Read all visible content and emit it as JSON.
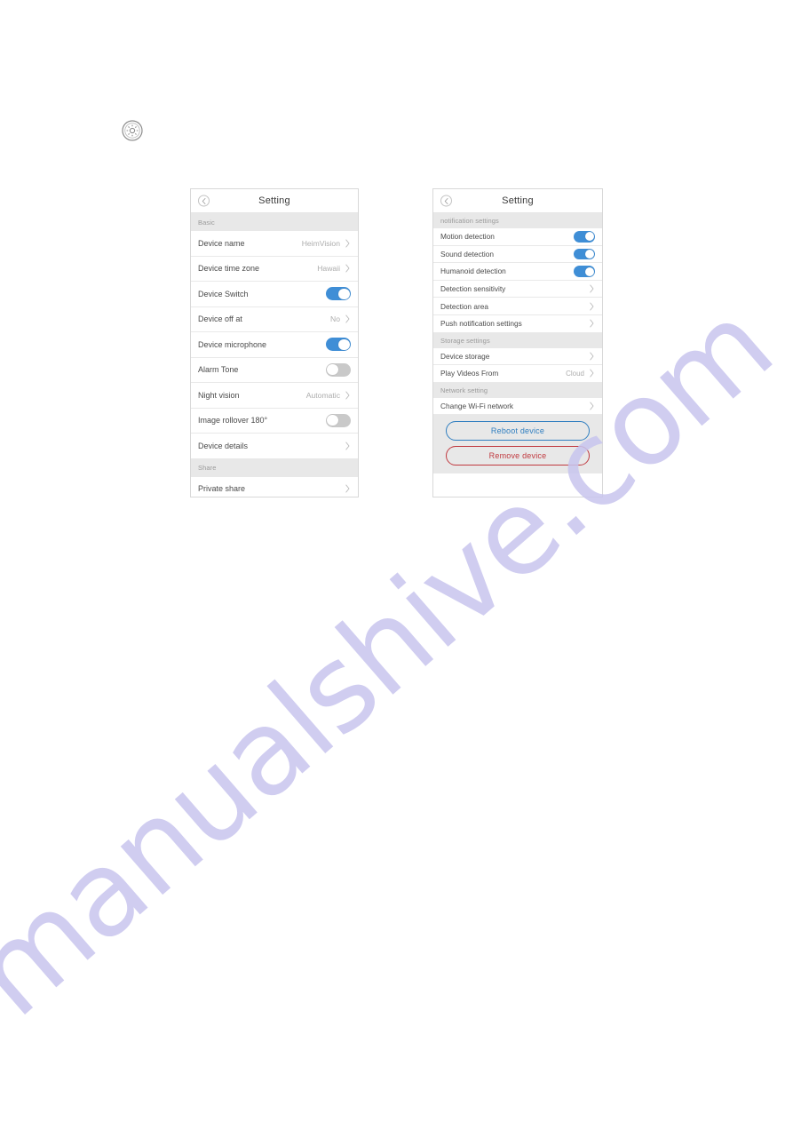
{
  "page": {
    "gear_icon": "gear-icon",
    "watermark": "manualshive.com",
    "watermark_color": "#c8c5ee"
  },
  "colors": {
    "toggle_on": "#3f8ed6",
    "toggle_off": "#c9c9c9",
    "reboot_outline": "#2f7ec0",
    "remove_outline": "#c0393f",
    "section_header_bg": "#e8e8e8"
  },
  "left_panel": {
    "title": "Setting",
    "back_icon": "chevron-left-icon",
    "sections": [
      {
        "header": "Basic",
        "rows": [
          {
            "label": "Device name",
            "value": "HeimVision",
            "control": "chevron"
          },
          {
            "label": "Device time zone",
            "value": "Hawaii",
            "control": "chevron"
          },
          {
            "label": "Device Switch",
            "value": "",
            "control": "toggle",
            "state": "on"
          },
          {
            "label": "Device off at",
            "value": "No",
            "control": "chevron"
          },
          {
            "label": "Device microphone",
            "value": "",
            "control": "toggle",
            "state": "on"
          },
          {
            "label": "Alarm Tone",
            "value": "",
            "control": "toggle",
            "state": "off"
          },
          {
            "label": "Night vision",
            "value": "Automatic",
            "control": "chevron"
          },
          {
            "label": "Image rollover 180°",
            "value": "",
            "control": "toggle",
            "state": "off"
          },
          {
            "label": "Device details",
            "value": "",
            "control": "chevron"
          }
        ]
      },
      {
        "header": "Share",
        "rows": [
          {
            "label": "Private share",
            "value": "",
            "control": "chevron"
          }
        ]
      }
    ]
  },
  "right_panel": {
    "title": "Setting",
    "back_icon": "chevron-left-icon",
    "sections": [
      {
        "header": "notification settings",
        "rows": [
          {
            "label": "Motion detection",
            "value": "",
            "control": "toggle",
            "state": "on"
          },
          {
            "label": "Sound detection",
            "value": "",
            "control": "toggle",
            "state": "on"
          },
          {
            "label": "Humanoid detection",
            "value": "",
            "control": "toggle",
            "state": "on"
          },
          {
            "label": "Detection sensitivity",
            "value": "",
            "control": "chevron"
          },
          {
            "label": "Detection area",
            "value": "",
            "control": "chevron"
          },
          {
            "label": "Push notification settings",
            "value": "",
            "control": "chevron"
          }
        ]
      },
      {
        "header": "Storage settings",
        "rows": [
          {
            "label": "Device storage",
            "value": "",
            "control": "chevron"
          },
          {
            "label": "Play Videos From",
            "value": "Cloud",
            "control": "chevron"
          }
        ]
      },
      {
        "header": "Network setting",
        "rows": [
          {
            "label": "Change Wi-Fi network",
            "value": "",
            "control": "chevron"
          }
        ]
      }
    ],
    "actions": [
      {
        "label": "Reboot device",
        "style": "reboot"
      },
      {
        "label": "Remove device",
        "style": "remove"
      }
    ]
  }
}
